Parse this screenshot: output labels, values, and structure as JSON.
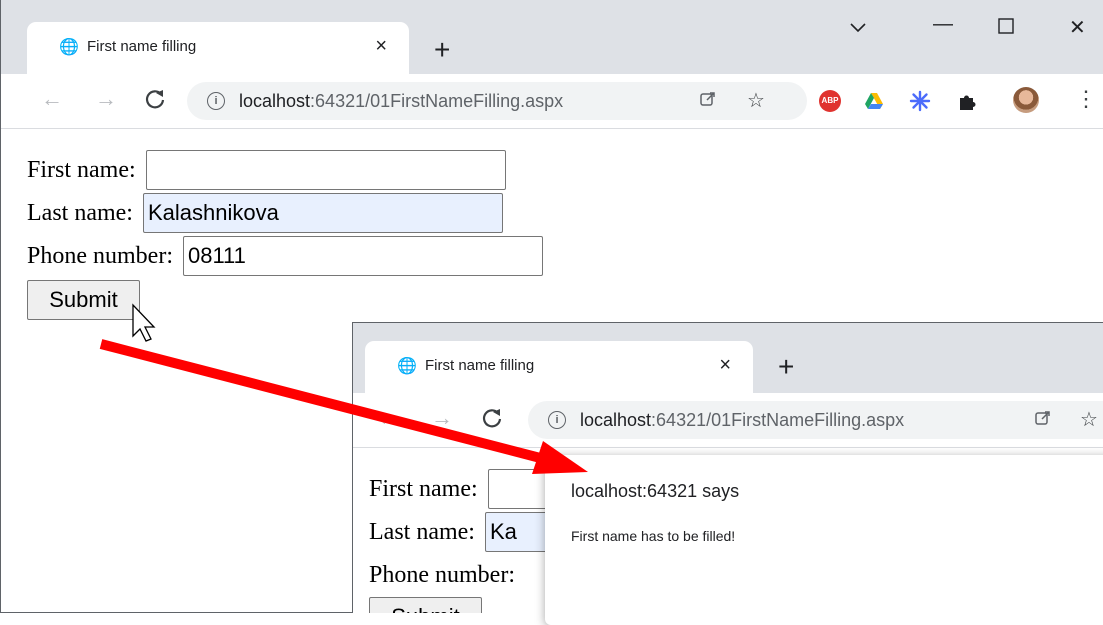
{
  "window1": {
    "tab_title": "First name filling",
    "tab_close": "×",
    "new_tab": "+",
    "controls": {
      "minimize": "—",
      "maximize": "☐",
      "close": "✕",
      "tab_search": "⌄"
    },
    "nav": {
      "back": "←",
      "forward": "→",
      "reload": "C"
    },
    "url_host": "localhost",
    "url_path": ":64321/01FirstNameFilling.aspx",
    "extensions": {
      "abp_label": "ABP"
    },
    "form": {
      "first_name_label": "First name:",
      "first_name_value": "",
      "last_name_label": "Last name:",
      "last_name_value": "Kalashnikova",
      "phone_label": "Phone number:",
      "phone_value": "08111",
      "submit_label": "Submit"
    }
  },
  "window2": {
    "tab_title": "First name filling",
    "tab_close": "×",
    "new_tab": "+",
    "nav": {
      "back": "←",
      "forward": "→",
      "reload": "C"
    },
    "url_host": "localhost",
    "url_path": ":64321/01FirstNameFilling.aspx",
    "form": {
      "first_name_label": "First name:",
      "last_name_label": "Last name:",
      "last_name_value": "Ka",
      "phone_label": "Phone number:",
      "submit_label": "Submit"
    },
    "dialog": {
      "title": "localhost:64321 says",
      "message": "First name has to be filled!"
    }
  },
  "colors": {
    "arrow": "#ff0000",
    "tabstrip": "#dee1e6",
    "omnibox": "#f1f3f4",
    "autofill": "#e8f0fe"
  }
}
